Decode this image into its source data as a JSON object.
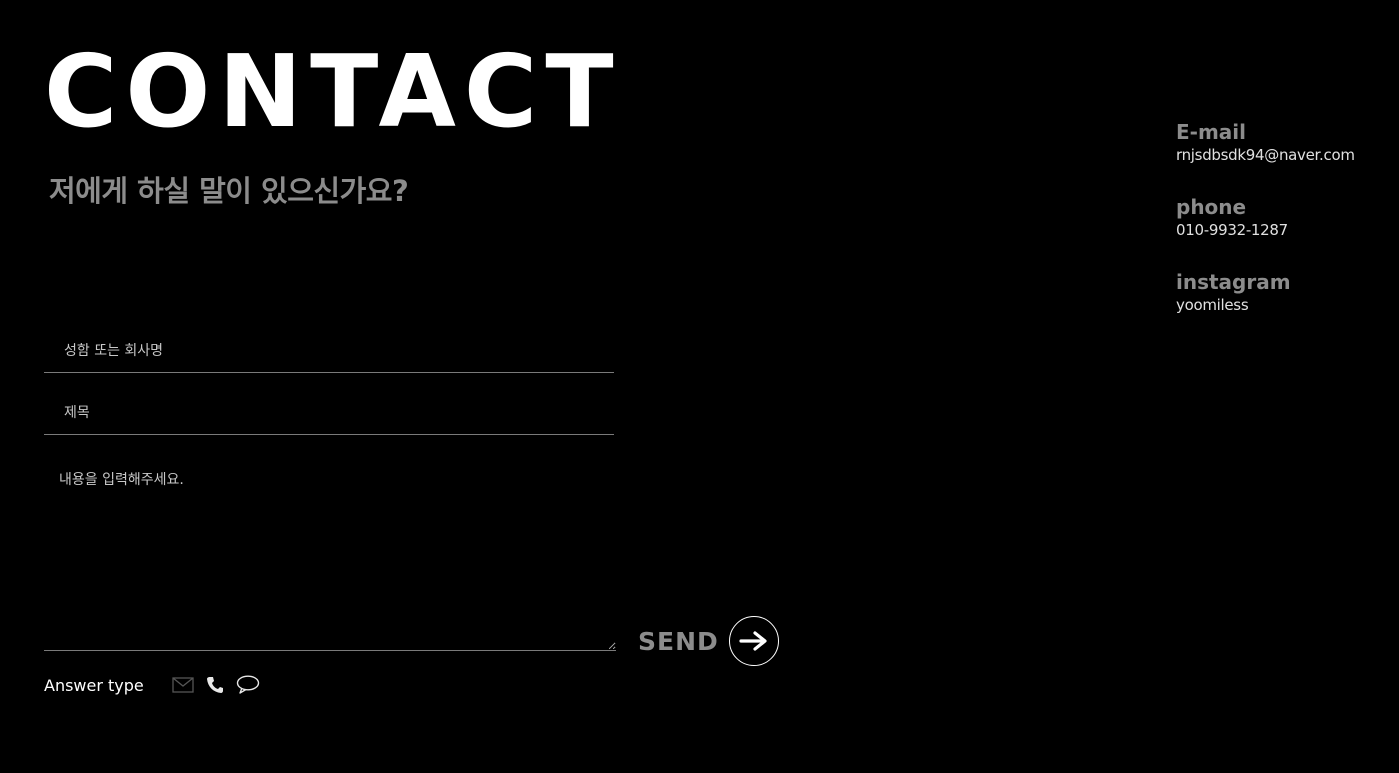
{
  "header": {
    "title": "CONTACT",
    "subtitle": "저에게 하실 말이 있으신가요?"
  },
  "form": {
    "name_placeholder": "성함 또는 회사명",
    "subject_placeholder": "제목",
    "message_placeholder": "내용을 입력해주세요.",
    "send_label": "SEND",
    "answer_type_label": "Answer type",
    "answer_types": [
      "mail-icon",
      "phone-icon",
      "chat-icon"
    ]
  },
  "contact_info": {
    "email_label": "E-mail",
    "email_value": "rnjsdbsdk94@naver.com",
    "phone_label": "phone",
    "phone_value": "010-9932-1287",
    "instagram_label": "instagram",
    "instagram_value": "yoomiless"
  },
  "colors": {
    "background": "#000000",
    "text": "#ffffff",
    "muted": "#8c8c8c",
    "divider": "#7a7a7a"
  }
}
